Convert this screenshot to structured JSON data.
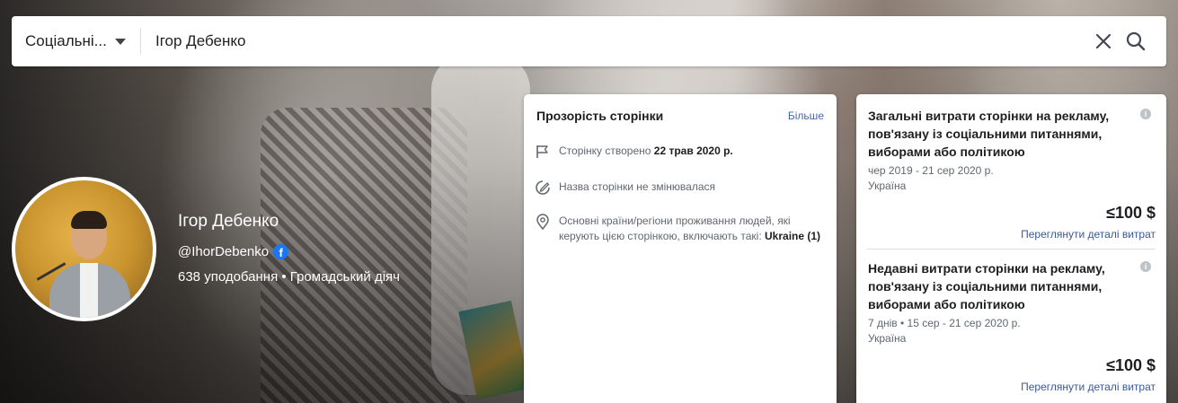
{
  "search": {
    "filter_label": "Соціальні...",
    "query": "Ігор Дебенко",
    "clear_icon": "close-icon",
    "search_icon": "search-icon"
  },
  "profile": {
    "name": "Ігор Дебенко",
    "handle": "@IhorDebenko",
    "meta": "638 уподобання • Громадський діяч"
  },
  "transparency": {
    "title": "Прозорість сторінки",
    "more": "Більше",
    "created_label": "Сторінку створено",
    "created_date": "22 трав 2020 р.",
    "name_unchanged": "Назва сторінки не змінювалася",
    "countries_label": "Основні країни/регіони проживання людей, які керують цією сторінкою, включають такі:",
    "countries_value": "Ukraine (1)"
  },
  "spending": {
    "total": {
      "title": "Загальні витрати сторінки на рекламу, пов'язану із соціальними питаннями, виборами або політикою",
      "dates": "чер 2019 - 21 сер 2020 р.",
      "country": "Україна",
      "amount": "≤100 $",
      "link": "Переглянути деталі витрат"
    },
    "recent": {
      "title": "Недавні витрати сторінки на рекламу, пов'язану із соціальними питаннями, виборами або політикою",
      "dates": "7 днів • 15 сер - 21 сер 2020 р.",
      "country": "Україна",
      "amount": "≤100 $",
      "link": "Переглянути деталі витрат"
    }
  },
  "colors": {
    "link": "#4267b2",
    "fb_blue": "#1877f2"
  }
}
